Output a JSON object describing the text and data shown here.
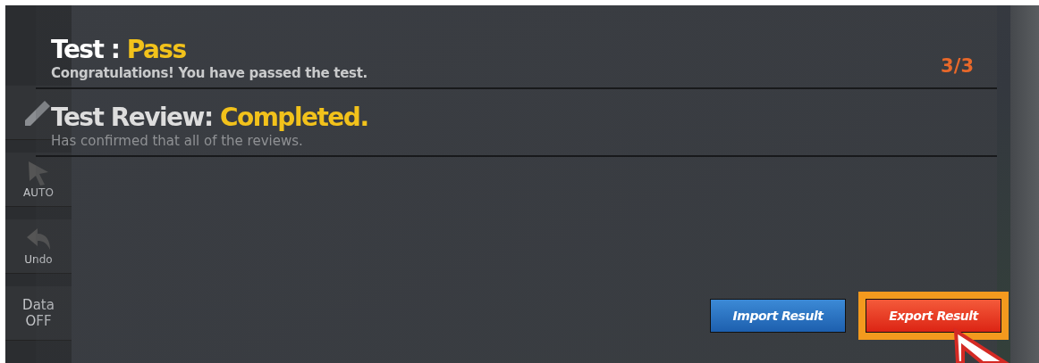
{
  "sidebar": {
    "items": [
      {
        "kind": "pencil"
      },
      {
        "kind": "cursor",
        "label": "AUTO"
      },
      {
        "kind": "undo",
        "label": "Undo"
      },
      {
        "kind": "text",
        "label": "Data OFF"
      }
    ]
  },
  "result": {
    "label": "Test :",
    "status": "Pass",
    "message": "Congratulations! You have passed the test.",
    "counter": "3/3"
  },
  "review": {
    "label": "Test Review:",
    "status": "Completed.",
    "message": "Has confirmed that all of the reviews."
  },
  "buttons": [
    {
      "label": "Import Result",
      "kind": "import",
      "highlighted": false
    },
    {
      "label": "Export Result",
      "kind": "export",
      "highlighted": true
    }
  ]
}
